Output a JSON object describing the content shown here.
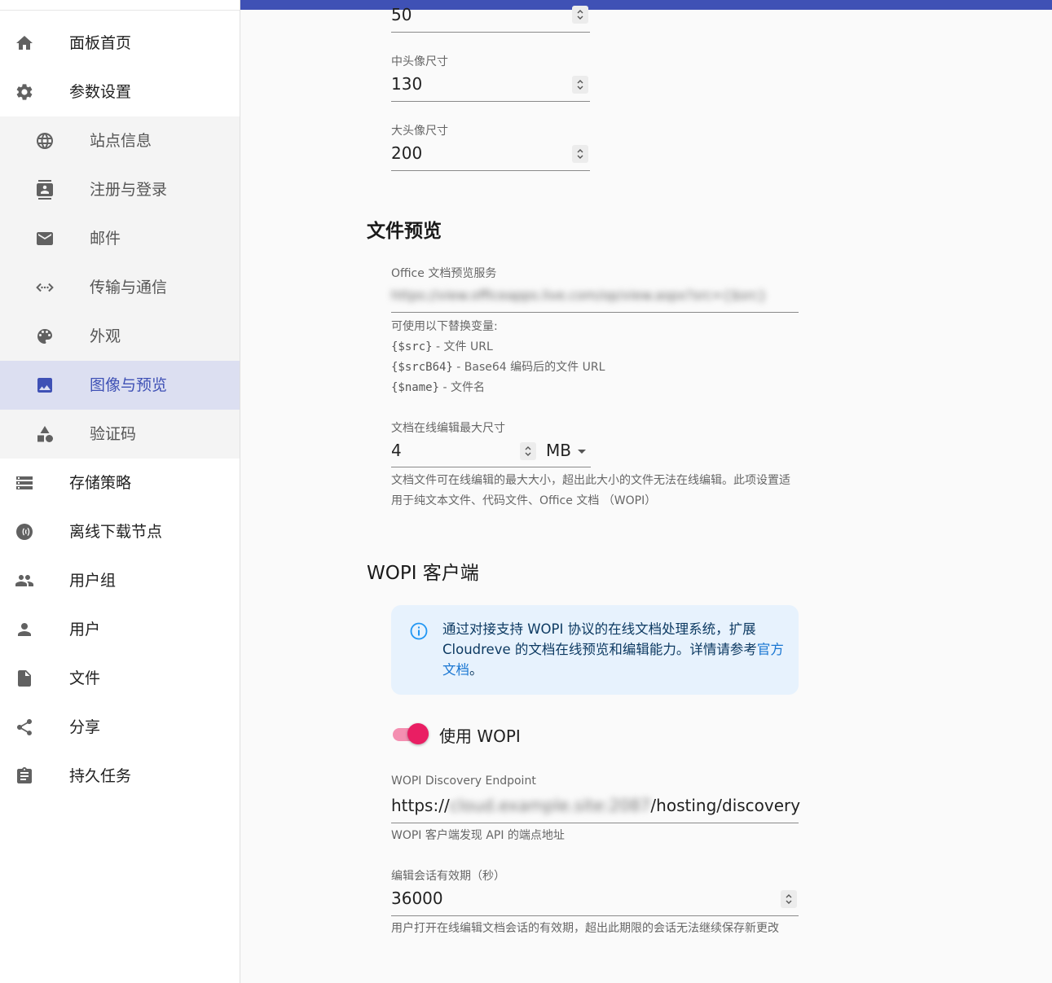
{
  "sidebar": {
    "items": [
      {
        "label": "面板首页",
        "icon": "home-icon"
      },
      {
        "label": "参数设置",
        "icon": "gear-icon"
      },
      {
        "label": "站点信息",
        "icon": "globe-icon"
      },
      {
        "label": "注册与登录",
        "icon": "contacts-icon"
      },
      {
        "label": "邮件",
        "icon": "mail-icon"
      },
      {
        "label": "传输与通信",
        "icon": "code-arrows-icon"
      },
      {
        "label": "外观",
        "icon": "palette-icon"
      },
      {
        "label": "图像与预览",
        "icon": "image-icon"
      },
      {
        "label": "验证码",
        "icon": "shapes-icon"
      },
      {
        "label": "存储策略",
        "icon": "storage-icon"
      },
      {
        "label": "离线下载节点",
        "icon": "download-node-icon"
      },
      {
        "label": "用户组",
        "icon": "group-icon"
      },
      {
        "label": "用户",
        "icon": "person-icon"
      },
      {
        "label": "文件",
        "icon": "file-icon"
      },
      {
        "label": "分享",
        "icon": "share-icon"
      },
      {
        "label": "持久任务",
        "icon": "clipboard-icon"
      }
    ],
    "selected": "图像与预览"
  },
  "avatar": {
    "small_value": "50",
    "medium_label": "中头像尺寸",
    "medium_value": "130",
    "large_label": "大头像尺寸",
    "large_value": "200"
  },
  "preview": {
    "title": "文件预览",
    "office_label": "Office 文档预览服务",
    "office_value": "https://view.officeapps.live.com/op/view.aspx?src={$src}",
    "vars_intro": "可使用以下替换变量:",
    "var1_code": "{$src}",
    "var1_desc": " - 文件 URL",
    "var2_code": "{$srcB64}",
    "var2_desc": " - Base64 编码后的文件 URL",
    "var3_code": "{$name}",
    "var3_desc": " - 文件名",
    "max_size_label": "文档在线编辑最大尺寸",
    "max_size_value": "4",
    "max_size_unit": "MB",
    "max_size_help": "文档文件可在线编辑的最大大小，超出此大小的文件无法在线编辑。此项设置适用于纯文本文件、代码文件、Office 文档 （WOPI）"
  },
  "wopi": {
    "title": "WOPI 客户端",
    "info_text": "通过对接支持 WOPI 协议的在线文档处理系统，扩展 Cloudreve 的文档在线预览和编辑能力。详情请参考",
    "info_link": "官方文档",
    "info_end": "。",
    "switch_label": "使用 WOPI",
    "switch_on": true,
    "endpoint_label": "WOPI Discovery Endpoint",
    "endpoint_prefix": "https://",
    "endpoint_hidden": "cloud.example.site:2087",
    "endpoint_suffix": "/hosting/discovery",
    "endpoint_help": "WOPI 客户端发现 API 的端点地址",
    "session_label": "编辑会话有效期（秒）",
    "session_value": "36000",
    "session_help": "用户打开在线编辑文档会话的有效期，超出此期限的会话无法继续保存新更改"
  },
  "colors": {
    "primary": "#3f51b5",
    "switch": "#e91e63",
    "info_bg": "#e7f2fd"
  }
}
